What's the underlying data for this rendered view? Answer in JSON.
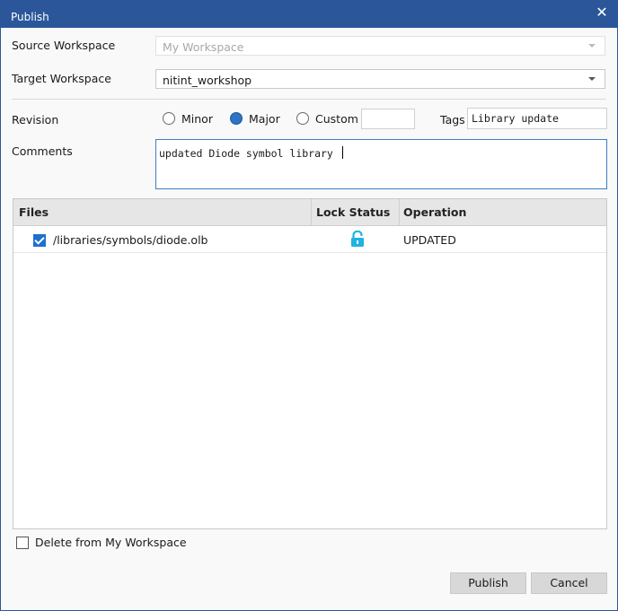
{
  "window": {
    "title": "Publish"
  },
  "source_workspace": {
    "label": "Source Workspace",
    "value": "My Workspace"
  },
  "target_workspace": {
    "label": "Target Workspace",
    "value": "nitint_workshop"
  },
  "revision": {
    "label": "Revision",
    "options": [
      {
        "label": "Minor",
        "selected": false
      },
      {
        "label": "Major",
        "selected": true
      },
      {
        "label": "Custom",
        "selected": false
      }
    ],
    "custom_value": ""
  },
  "tags": {
    "label": "Tags",
    "value": "Library update"
  },
  "comments": {
    "label": "Comments",
    "value": "updated Diode symbol library"
  },
  "files_table": {
    "columns": [
      "Files",
      "Lock Status",
      "Operation"
    ],
    "rows": [
      {
        "checked": true,
        "file": "/libraries/symbols/diode.olb",
        "lock_status": "unlocked-icon",
        "operation": "UPDATED"
      }
    ]
  },
  "delete_option": {
    "label": "Delete from My Workspace",
    "checked": false
  },
  "buttons": {
    "publish": "Publish",
    "cancel": "Cancel"
  },
  "colors": {
    "titlebar": "#2b579a",
    "accent": "#2e73c4",
    "lock_icon": "#1fb2e3"
  }
}
